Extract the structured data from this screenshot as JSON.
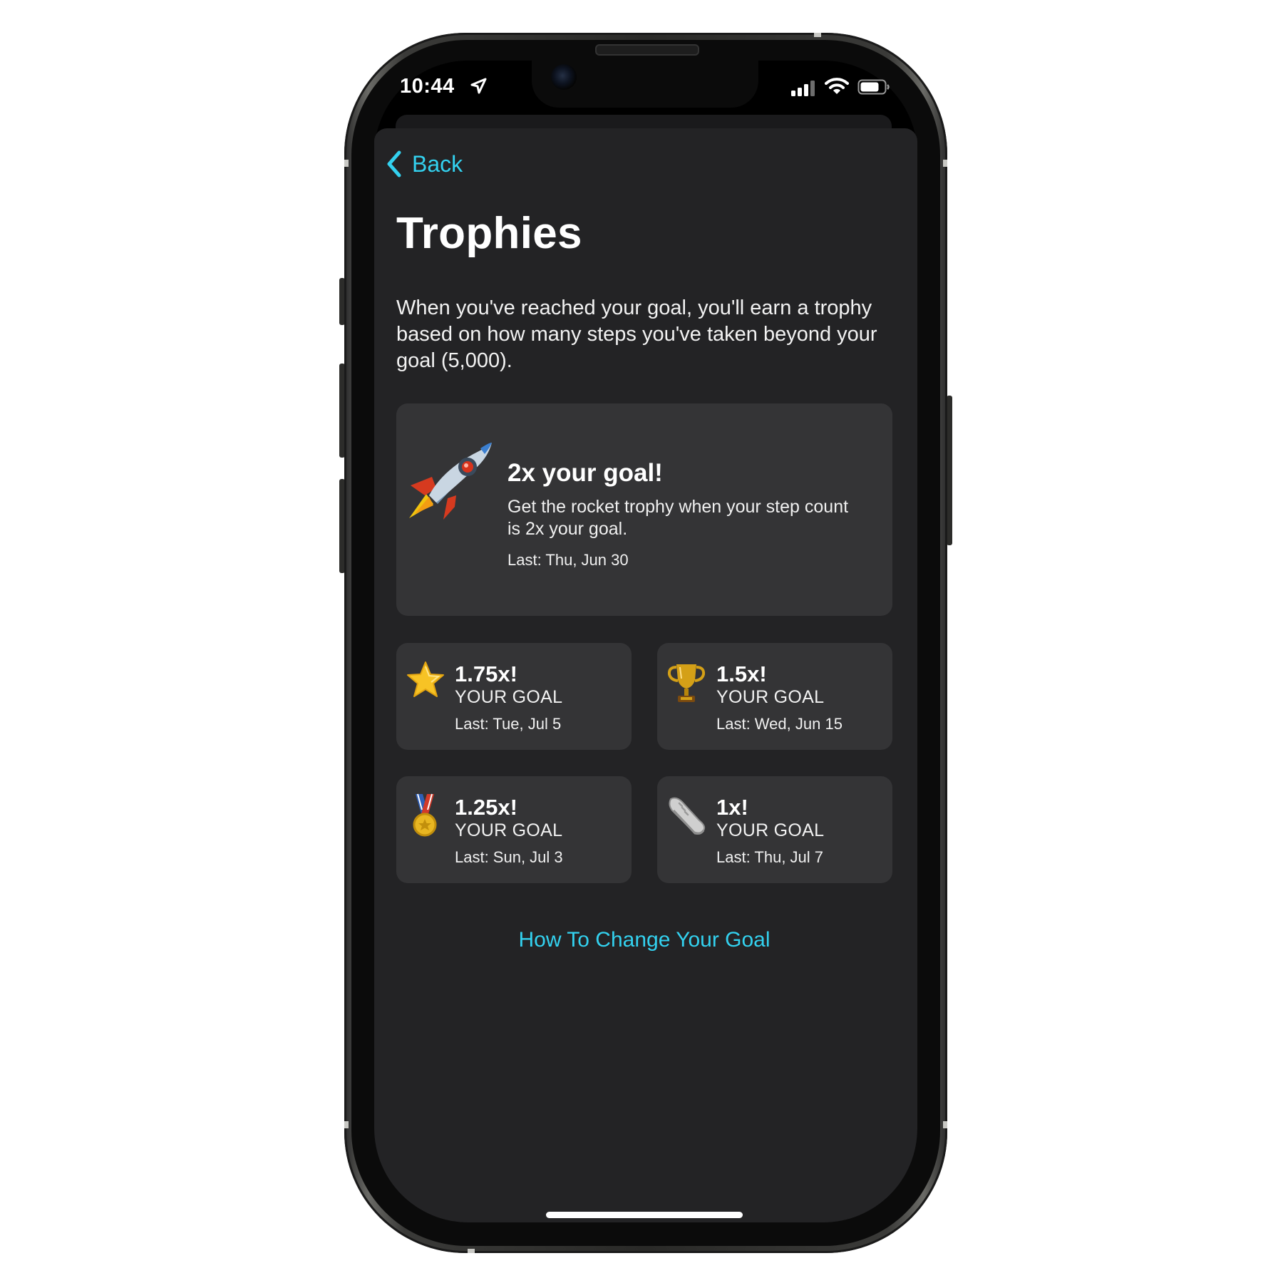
{
  "status_bar": {
    "time": "10:44"
  },
  "nav": {
    "back_label": "Back"
  },
  "page": {
    "title": "Trophies",
    "intro": "When you've reached your goal, you'll earn a trophy based on how many steps you've taken beyond your goal (5,000)."
  },
  "featured_trophy": {
    "icon": "rocket-icon",
    "title": "2x your goal!",
    "description": "Get the rocket trophy when your step count is 2x your goal.",
    "last": "Last: Thu, Jun 30"
  },
  "trophies": [
    {
      "icon": "star-icon",
      "title": "1.75x!",
      "subtitle": "YOUR GOAL",
      "last": "Last: Tue, Jul 5"
    },
    {
      "icon": "trophy-cup-icon",
      "title": "1.5x!",
      "subtitle": "YOUR GOAL",
      "last": "Last: Wed, Jun 15"
    },
    {
      "icon": "medal-icon",
      "title": "1.25x!",
      "subtitle": "YOUR GOAL",
      "last": "Last: Sun, Jul 3"
    },
    {
      "icon": "sneaker-icon",
      "title": "1x!",
      "subtitle": "YOUR GOAL",
      "last": "Last: Thu, Jul 7"
    }
  ],
  "footer": {
    "link_label": "How To Change Your Goal"
  },
  "colors": {
    "accent": "#33d1ef",
    "sheet_background": "#232325",
    "card_background": "#343436",
    "text": "#ffffff"
  }
}
